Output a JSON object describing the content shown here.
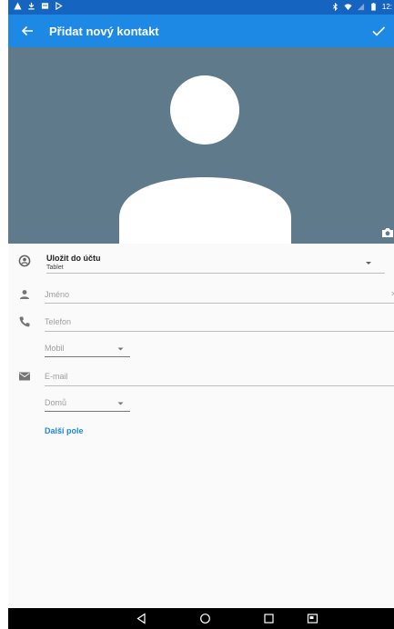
{
  "status_bar": {
    "time": "12:",
    "left_icons": [
      "warning-icon",
      "download-icon",
      "notification-box-icon",
      "play-store-icon"
    ],
    "right_icons": [
      "bluetooth-icon",
      "wifi-icon",
      "signal-icon",
      "battery-icon"
    ]
  },
  "app_bar": {
    "title": "Přidat nový kontakt",
    "back_icon": "arrow-left-icon",
    "save_icon": "check-icon",
    "color": "#1e88e5",
    "status_color": "#1565c0"
  },
  "photo": {
    "background_color": "#5f7b8b",
    "camera_icon": "camera-icon"
  },
  "account": {
    "label": "Uložit do účtu",
    "value": "Tablet"
  },
  "fields": {
    "name_placeholder": "Jméno",
    "phone_placeholder": "Telefon",
    "phone_type": "Mobil",
    "email_placeholder": "E-mail",
    "email_type": "Domů"
  },
  "more_fields_label": "Další pole",
  "nav_bar": {
    "buttons": [
      "back-triangle-icon",
      "home-circle-icon",
      "recents-square-icon",
      "screenshot-icon"
    ]
  },
  "accent_color": "#1e88e5"
}
